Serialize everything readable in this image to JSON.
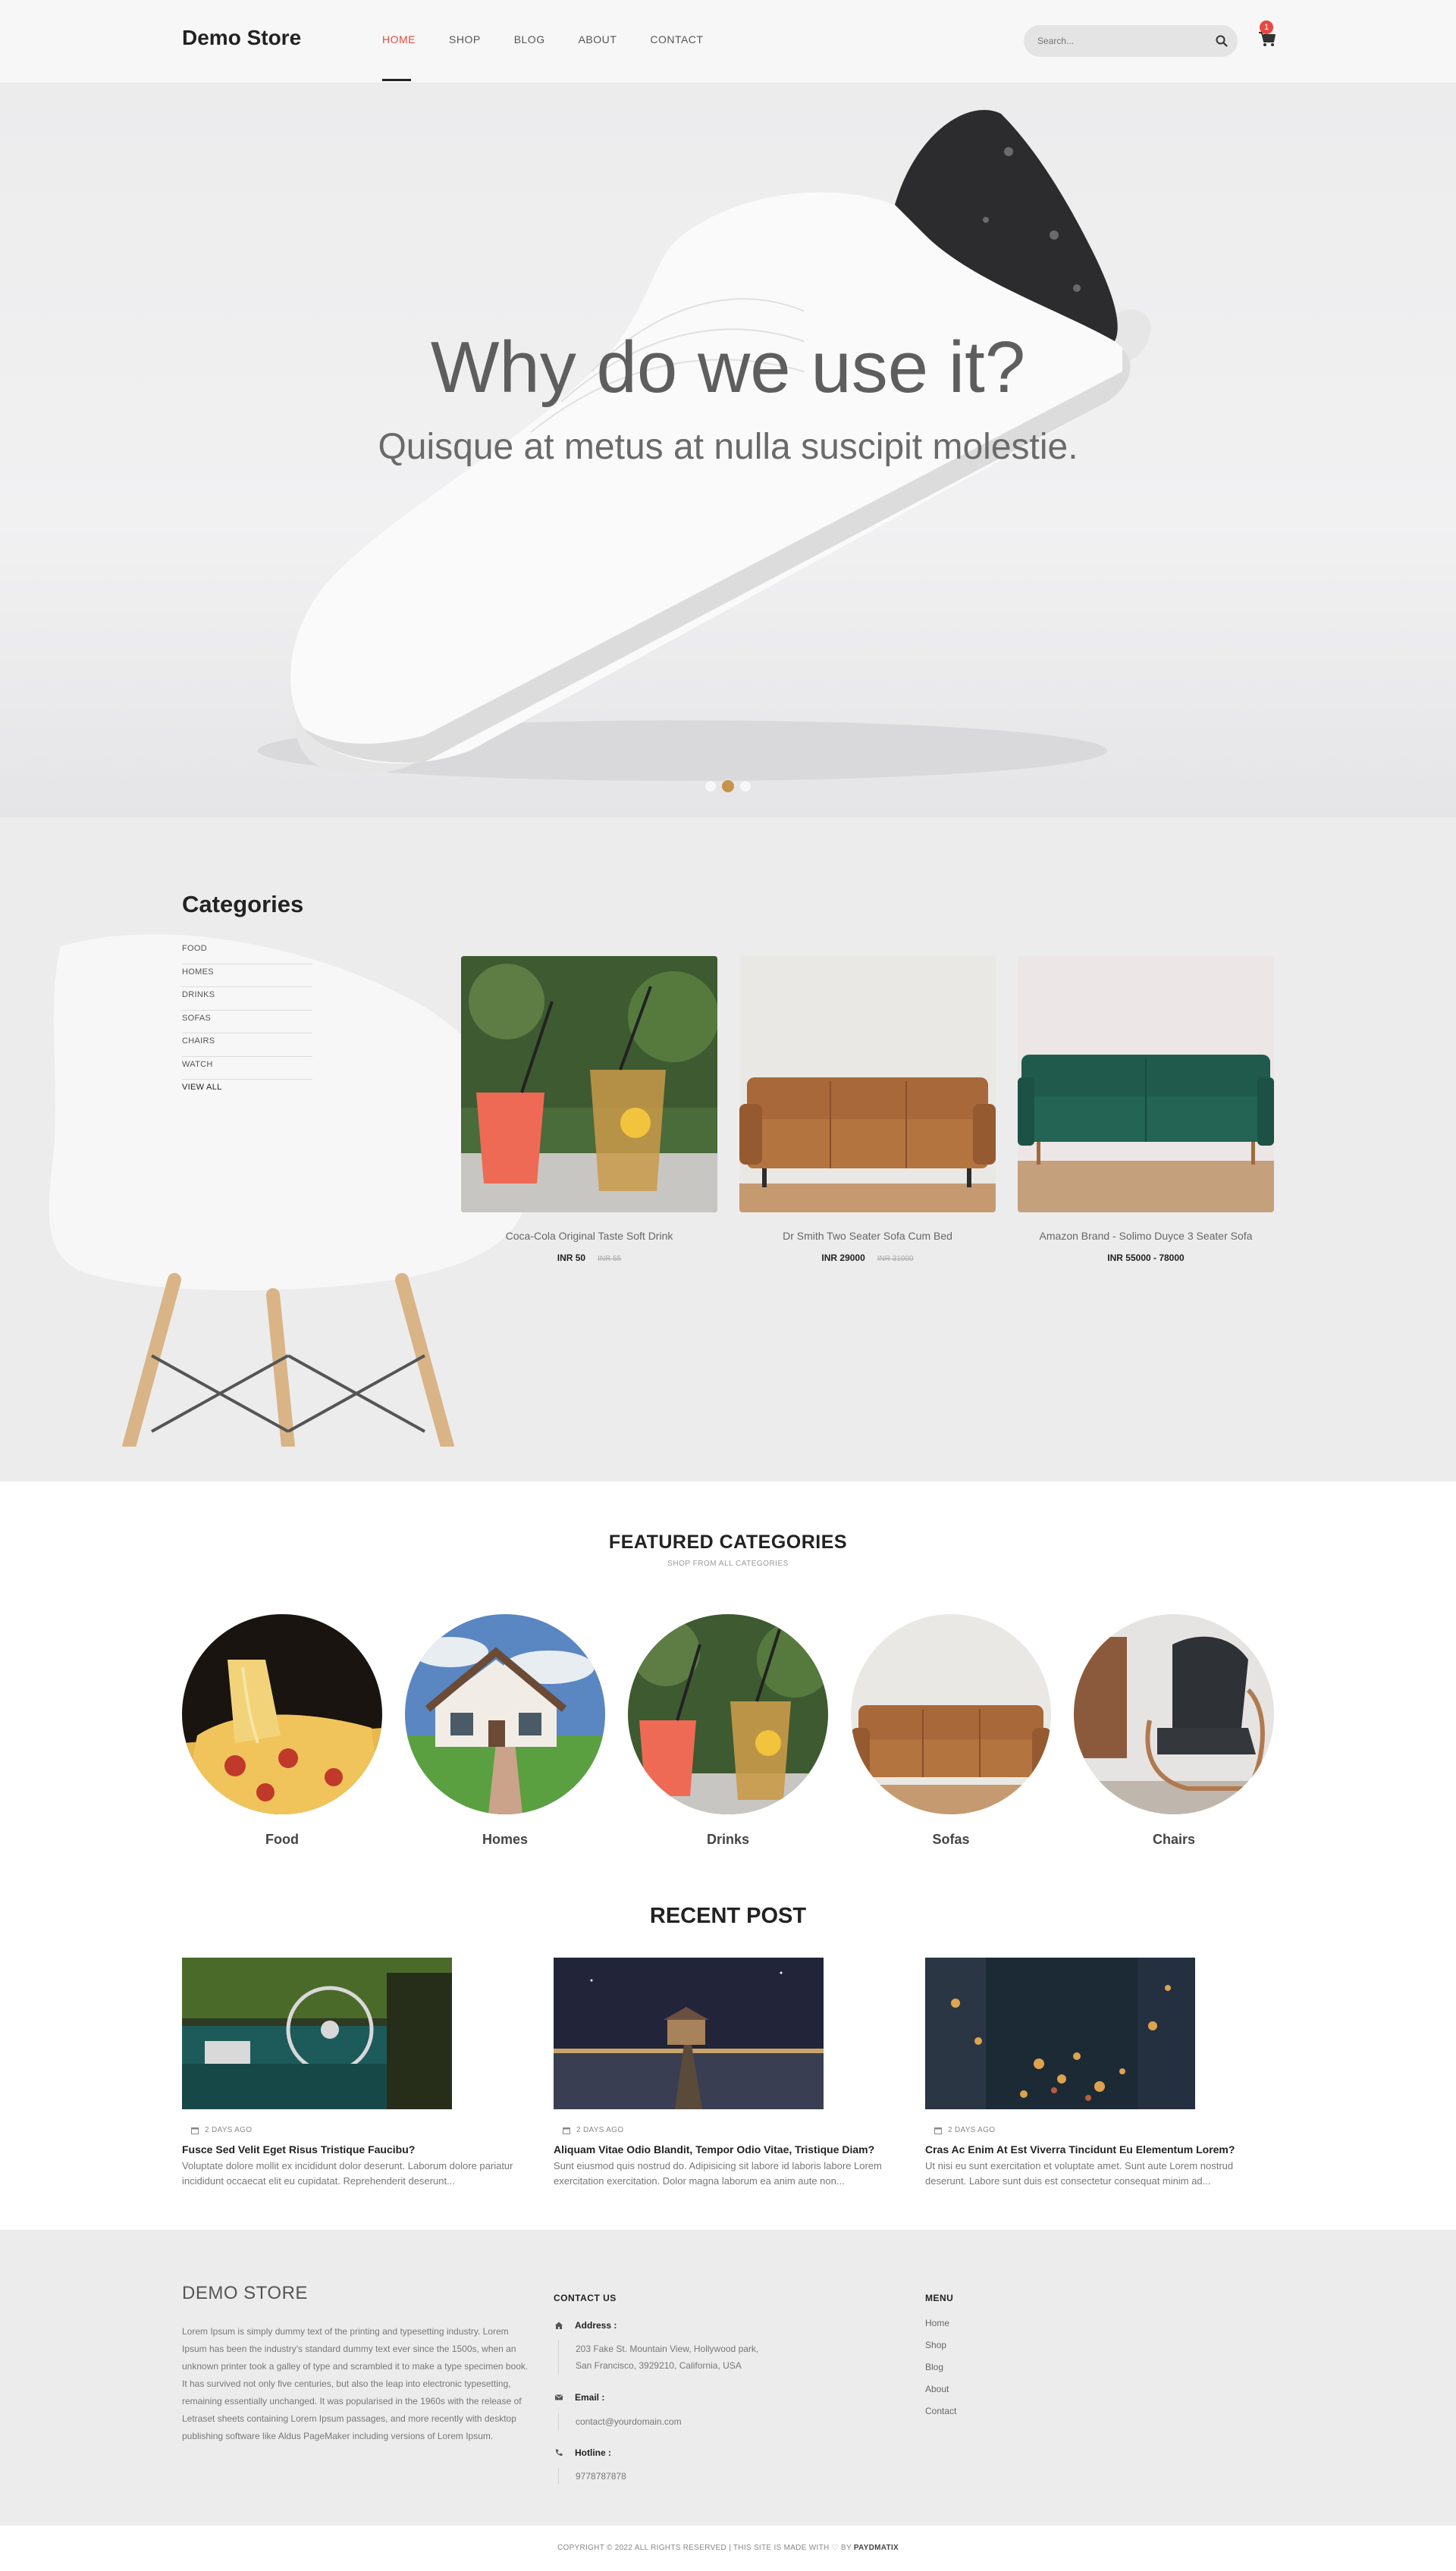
{
  "header": {
    "logo": "Demo Store",
    "nav": [
      "HOME",
      "SHOP",
      "BLOG",
      "ABOUT",
      "CONTACT"
    ],
    "active_nav": "HOME",
    "search_placeholder": "Search...",
    "cart_count": "1",
    "accent_color": "#e8493f"
  },
  "hero": {
    "title": "Why do we use it?",
    "subtitle": "Quisque at metus at nulla suscipit molestie.",
    "slides": 3,
    "active_slide": 2
  },
  "categories": {
    "title": "Categories",
    "items": [
      "FOOD",
      "HOMES",
      "DRINKS",
      "SOFAS",
      "CHAIRS",
      "WATCH"
    ],
    "view_all": "VIEW ALL",
    "products": [
      {
        "name": "Coca-Cola Original Taste Soft Drink",
        "price": "INR 50",
        "old_price": "INR 55"
      },
      {
        "name": "Dr Smith Two Seater Sofa Cum Bed",
        "price": "INR 29000",
        "old_price": "INR 31000"
      },
      {
        "name": "Amazon Brand - Solimo Duyce 3 Seater Sofa",
        "price": "INR 55000 - 78000",
        "old_price": ""
      }
    ]
  },
  "featured": {
    "title": "FEATURED CATEGORIES",
    "subtitle": "SHOP FROM ALL CATEGORIES",
    "items": [
      "Food",
      "Homes",
      "Drinks",
      "Sofas",
      "Chairs"
    ]
  },
  "recent": {
    "title": "RECENT POST",
    "posts": [
      {
        "date": "2 DAYS AGO",
        "title": "Fusce Sed Velit Eget Risus Tristique Faucibu?",
        "excerpt": "Voluptate dolore mollit ex incididunt dolor deserunt. Laborum dolore pariatur incididunt occaecat elit eu cupidatat. Reprehenderit deserunt..."
      },
      {
        "date": "2 DAYS AGO",
        "title": "Aliquam Vitae Odio Blandit, Tempor Odio Vitae, Tristique Diam?",
        "excerpt": "Sunt eiusmod quis nostrud do. Adipisicing sit labore id laboris labore Lorem exercitation exercitation. Dolor magna laborum ea anim aute non..."
      },
      {
        "date": "2 DAYS AGO",
        "title": "Cras Ac Enim At Est Viverra Tincidunt Eu Elementum Lorem?",
        "excerpt": "Ut nisi eu sunt exercitation et voluptate amet. Sunt aute Lorem nostrud deserunt. Labore sunt duis est consectetur consequat minim ad..."
      }
    ]
  },
  "footer": {
    "brand": "DEMO STORE",
    "about": "Lorem Ipsum is simply dummy text of the printing and typesetting industry. Lorem Ipsum has been the industry's standard dummy text ever since the 1500s, when an unknown printer took a galley of type and scrambled it to make a type specimen book. It has survived not only five centuries, but also the leap into electronic typesetting, remaining essentially unchanged. It was popularised in the 1960s with the release of Letraset sheets containing Lorem Ipsum passages, and more recently with desktop publishing software like Aldus PageMaker including versions of Lorem Ipsum.",
    "contact_title": "CONTACT US",
    "address_label": "Address :",
    "address_line1": "203 Fake St. Mountain View, Hollywood park,",
    "address_line2": "San Francisco, 3929210, California, USA",
    "email_label": "Email :",
    "email": "contact@yourdomain.com",
    "hotline_label": "Hotline :",
    "hotline": "9778787878",
    "menu_title": "MENU",
    "menu": [
      "Home",
      "Shop",
      "Blog",
      "About",
      "Contact"
    ],
    "copyright_prefix": "COPYRIGHT © 2022 ALL RIGHTS RESERVED | THIS SITE IS MADE WITH",
    "copyright_by": "BY",
    "copyright_brand": "PAYDMATIX"
  }
}
